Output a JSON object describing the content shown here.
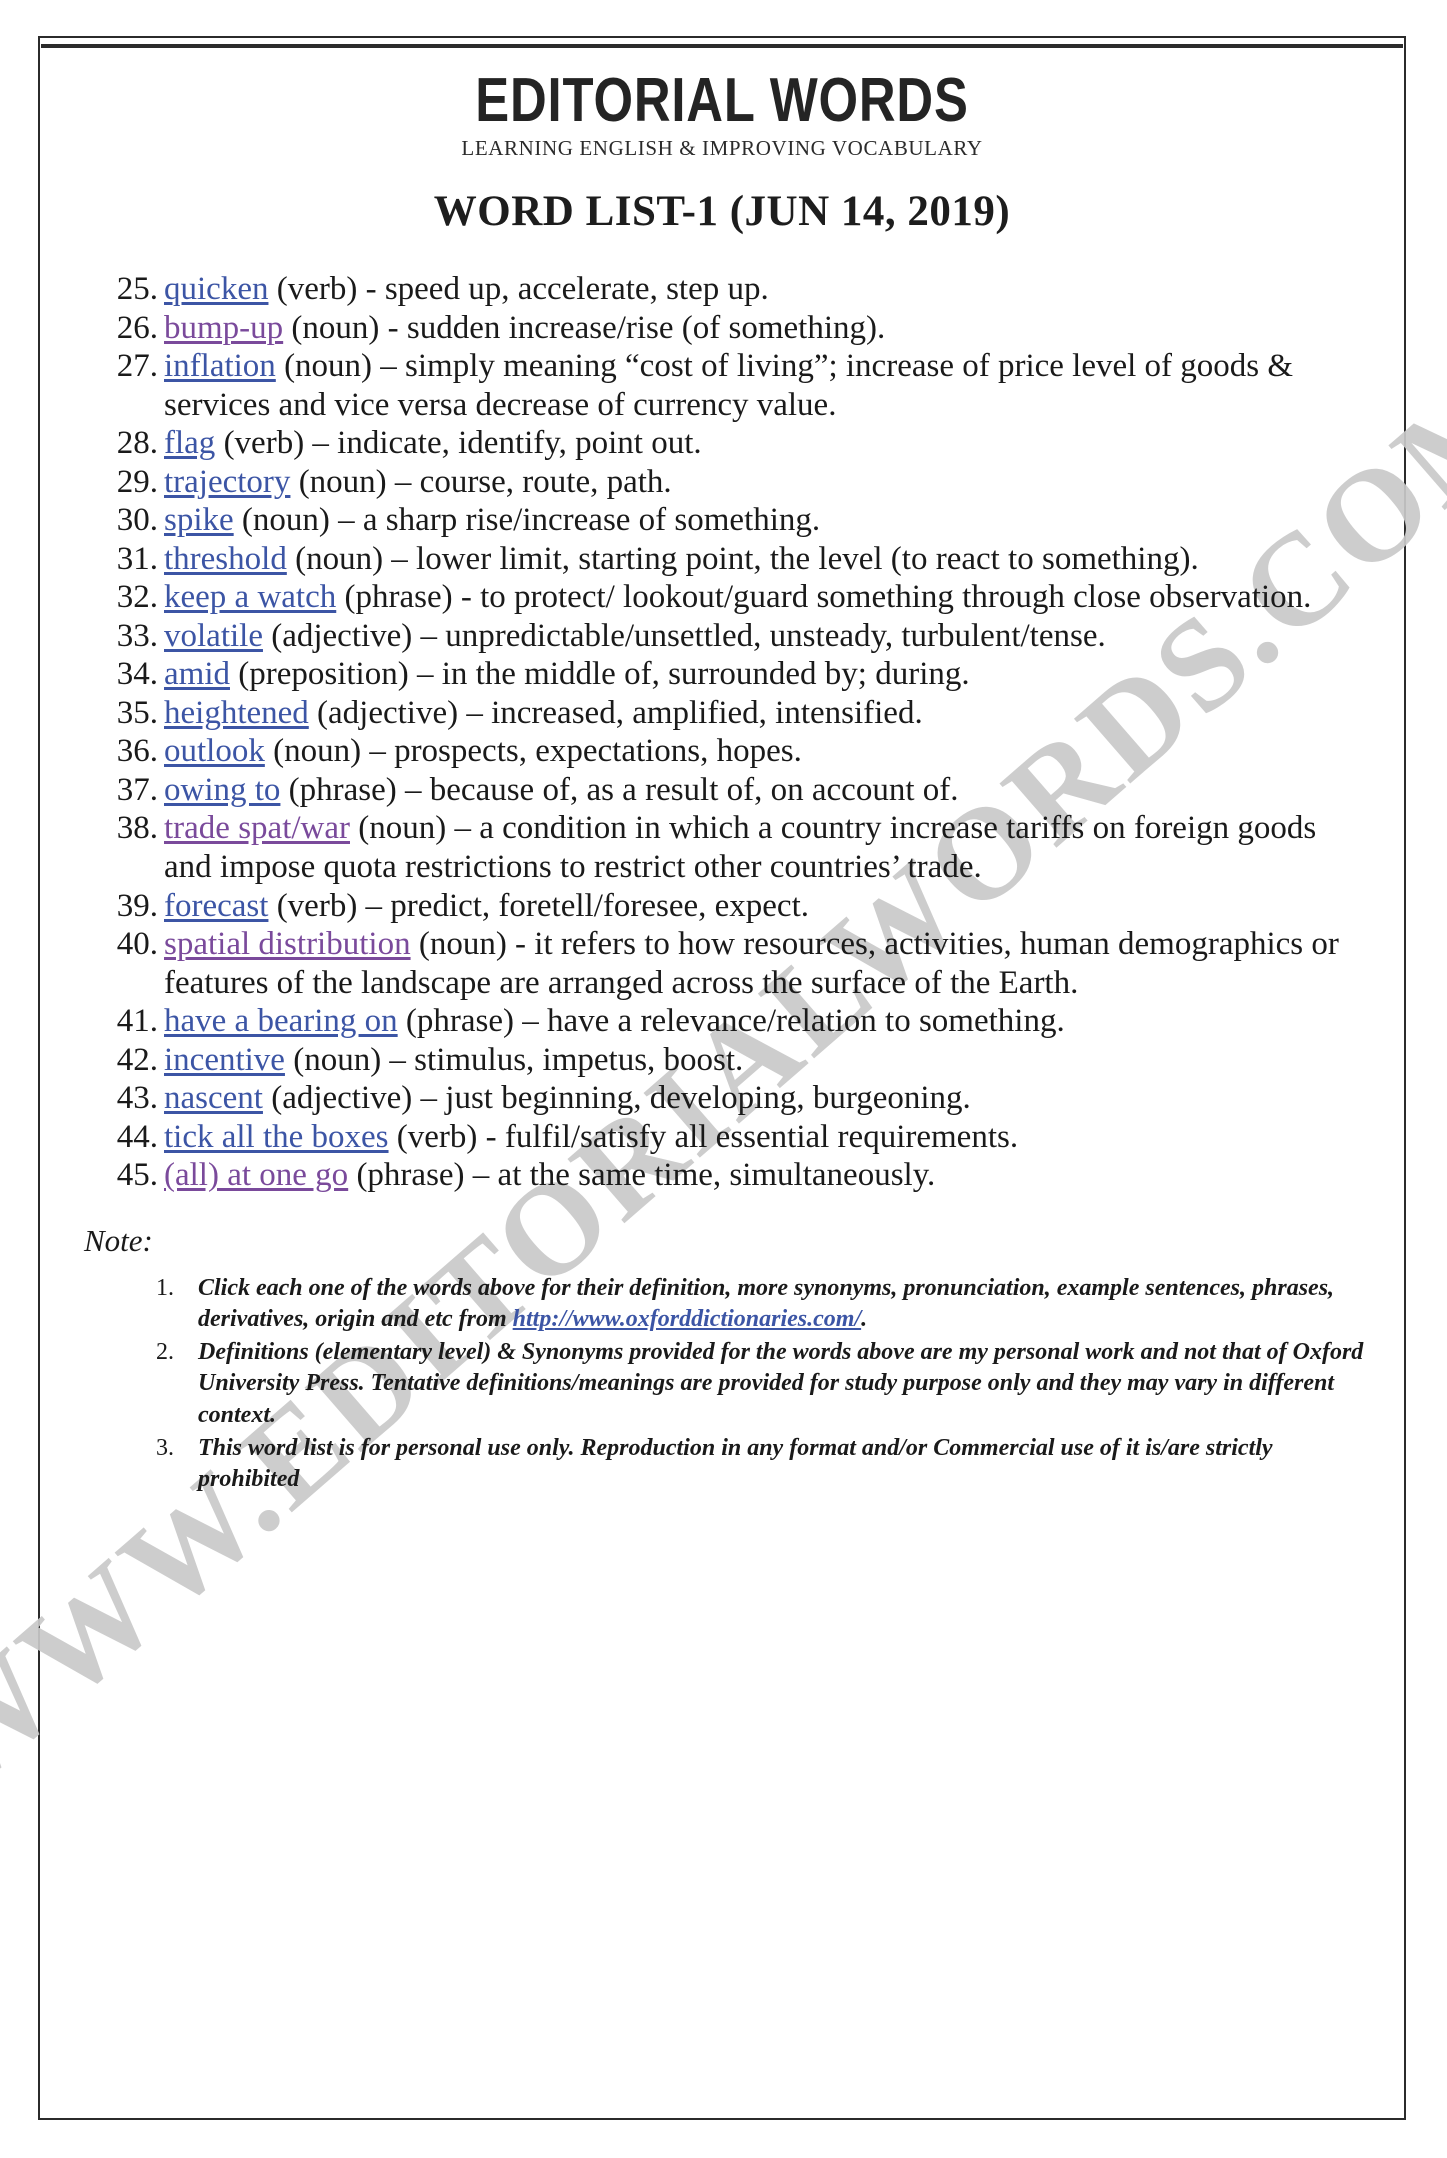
{
  "masthead": {
    "brand": "EDITORIAL WORDS",
    "tagline": "LEARNING ENGLISH & IMPROVING VOCABULARY",
    "title": "WORD LIST-1 (JUN 14, 2019)"
  },
  "watermark": {
    "text": "WWW.EDITORIALWORDS.COM",
    "color": "#c9c9c9"
  },
  "colors": {
    "link_blue": "#3c55a5",
    "link_purple": "#7a4a9b",
    "text": "#1a1a1a",
    "frame": "#2b2b2b"
  },
  "entries": [
    {
      "number": "25.",
      "word": "quicken",
      "link_color": "blue",
      "body": " (verb) - speed up, accelerate, step up."
    },
    {
      "number": "26.",
      "word": "bump-up",
      "link_color": "purple",
      "body": " (noun) - sudden increase/rise (of something)."
    },
    {
      "number": "27.",
      "word": "inflation",
      "link_color": "blue",
      "body": " (noun) – simply meaning “cost of living”; increase of price level of goods & services and vice versa decrease of currency value."
    },
    {
      "number": "28.",
      "word": "flag",
      "link_color": "blue",
      "body": " (verb) – indicate, identify, point out."
    },
    {
      "number": "29.",
      "word": "trajectory",
      "link_color": "blue",
      "body": " (noun) – course, route, path."
    },
    {
      "number": "30.",
      "word": "spike",
      "link_color": "blue",
      "body": " (noun) – a sharp rise/increase of something."
    },
    {
      "number": "31.",
      "word": "threshold",
      "link_color": "blue",
      "body": " (noun) – lower limit, starting point, the level (to react to something)."
    },
    {
      "number": "32.",
      "word": "keep a watch",
      "link_color": "blue",
      "body": " (phrase) - to protect/ lookout/guard something through close observation."
    },
    {
      "number": "33.",
      "word": "volatile",
      "link_color": "blue",
      "body": " (adjective) – unpredictable/unsettled, unsteady, turbulent/tense."
    },
    {
      "number": "34.",
      "word": "amid",
      "link_color": "blue",
      "body": " (preposition) – in the middle of, surrounded by; during."
    },
    {
      "number": "35.",
      "word": "heightened",
      "link_color": "blue",
      "body": " (adjective) – increased, amplified, intensified."
    },
    {
      "number": "36.",
      "word": "outlook",
      "link_color": "blue",
      "body": " (noun) – prospects, expectations, hopes."
    },
    {
      "number": "37.",
      "word": "owing to",
      "link_color": "blue",
      "body": " (phrase) – because of, as a result of, on account of."
    },
    {
      "number": "38.",
      "word": "trade spat/war",
      "link_color": "purple",
      "body": " (noun) – a condition in which a country increase tariffs on foreign goods and impose quota restrictions to restrict other countries’ trade."
    },
    {
      "number": "39.",
      "word": "forecast",
      "link_color": "blue",
      "body": " (verb) – predict, foretell/foresee, expect."
    },
    {
      "number": "40.",
      "word": "spatial distribution",
      "link_color": "purple",
      "body": " (noun) - it refers to how resources, activities, human demographics or features of the landscape are arranged across the surface of the Earth."
    },
    {
      "number": "41.",
      "word": "have a bearing on",
      "link_color": "blue",
      "body": " (phrase) – have a relevance/relation to something."
    },
    {
      "number": "42.",
      "word": "incentive",
      "link_color": "blue",
      "body": " (noun) – stimulus, impetus, boost."
    },
    {
      "number": "43.",
      "word": "nascent",
      "link_color": "blue",
      "body": " (adjective) – just beginning, developing, burgeoning."
    },
    {
      "number": "44.",
      "word": "tick all the boxes",
      "link_color": "blue",
      "body": " (verb) - fulfil/satisfy all essential requirements."
    },
    {
      "number": "45.",
      "word": "(all) at one go",
      "link_color": "purple",
      "body": " (phrase) – at the same time, simultaneously."
    }
  ],
  "note": {
    "label": "Note:",
    "items": [
      {
        "number": "1.",
        "text_before": "Click each one of the words above for their definition, more synonyms, pronunciation, example sentences, phrases, derivatives, origin and etc from ",
        "link": "http://www.oxforddictionaries.com/",
        "text_after": "."
      },
      {
        "number": "2.",
        "text_before": "Definitions (elementary level) & Synonyms provided for the words above are my personal work and not that of Oxford University Press. Tentative definitions/meanings are provided for study purpose only and they may vary in different context.",
        "link": "",
        "text_after": ""
      },
      {
        "number": "3.",
        "text_before": "This word list is for personal use only. Reproduction in any format and/or Commercial use of it is/are strictly prohibited",
        "link": "",
        "text_after": ""
      }
    ]
  }
}
